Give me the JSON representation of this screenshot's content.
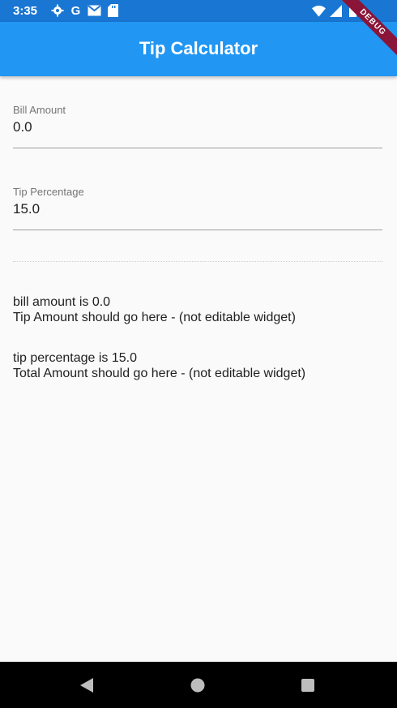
{
  "status_bar": {
    "time": "3:35",
    "left_icons": [
      "gear-icon",
      "google-icon",
      "gmail-icon",
      "sd-card-icon"
    ],
    "right_icons": [
      "wifi-icon",
      "cell-signal-icon",
      "battery-icon"
    ],
    "color": "#1976d2"
  },
  "app_bar": {
    "title": "Tip Calculator",
    "color": "#2196f3",
    "debug_banner": "DEBUG"
  },
  "form": {
    "bill_amount": {
      "label": "Bill Amount",
      "value": "0.0"
    },
    "tip_percentage": {
      "label": "Tip Percentage",
      "value": "15.0"
    }
  },
  "output": {
    "bill_line": "bill amount is 0.0",
    "tip_line": "Tip Amount should go here - (not editable widget)",
    "percent_line": "tip percentage is 15.0",
    "total_line": "Total Amount should go here - (not editable widget)"
  },
  "nav_bar": {
    "buttons": [
      "back-icon",
      "home-icon",
      "recents-icon"
    ]
  }
}
